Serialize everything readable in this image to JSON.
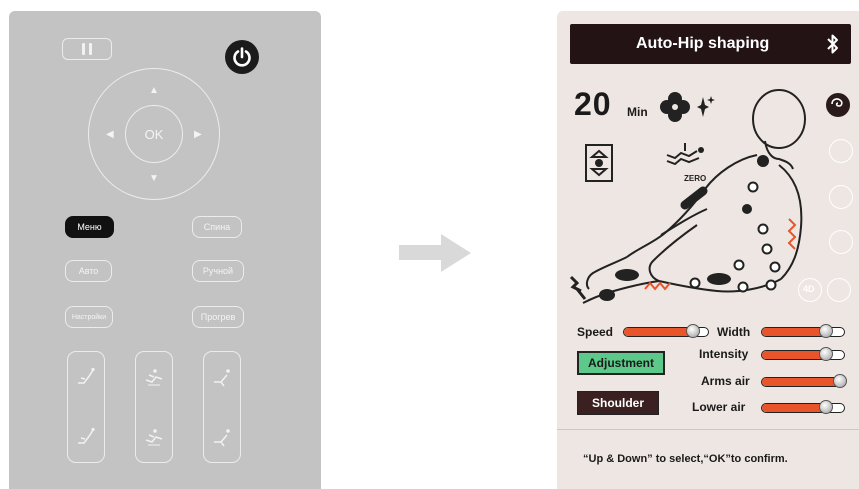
{
  "remote": {
    "ok_label": "OK",
    "buttons": {
      "menu": "Меню",
      "back": "Спина",
      "auto": "Авто",
      "manual": "Ручной",
      "settings": "Настройки",
      "heat": "Прогрев"
    }
  },
  "display": {
    "title": "Auto-Hip shaping",
    "time_value": "20",
    "time_unit": "Min",
    "zero_label": "ZERO",
    "sliders": {
      "speed": {
        "label": "Speed",
        "level": 0.82
      },
      "width": {
        "label": "Width",
        "level": 0.78
      },
      "intensity": {
        "label": "Intensity",
        "level": 0.78
      },
      "arms_air": {
        "label": "Arms air",
        "level": 0.95
      },
      "lower_air": {
        "label": "Lower air",
        "level": 0.78
      }
    },
    "adjustment_label": "Adjustment",
    "shoulder_label": "Shoulder",
    "mode_label_4d": "4D",
    "footer": "“Up &  Down” to select,“OK”to confirm.",
    "colors": {
      "accent": "#e8552a",
      "title_bg": "#231314",
      "adjust_bg": "#5cc98a"
    }
  }
}
